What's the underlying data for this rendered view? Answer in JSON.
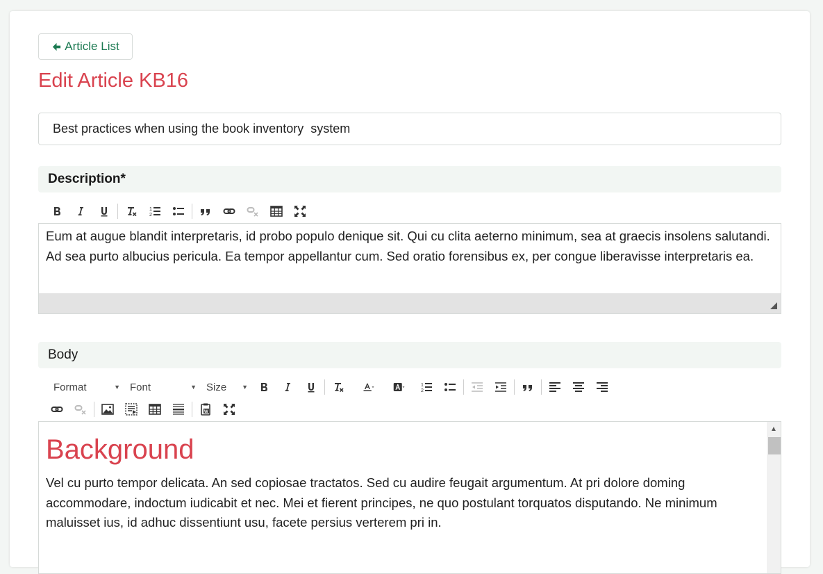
{
  "back_button": {
    "label": "Article List"
  },
  "page_title": "Edit Article KB16",
  "title_input": {
    "value": "Best practices when using the book inventory  system"
  },
  "description": {
    "label": "Description*",
    "text": "Eum at augue blandit interpretaris, id probo populo denique sit. Qui cu clita aeterno minimum, sea at graecis insolens salutandi. Ad sea purto albucius pericula. Ea tempor appellantur cum. Sed oratio forensibus ex, per congue liberavisse interpretaris ea."
  },
  "body": {
    "label": "Body",
    "format_combo": "Format",
    "font_combo": "Font",
    "size_combo": "Size",
    "heading": "Background",
    "text": "Vel cu purto tempor delicata. An sed copiosae tractatos. Sed cu audire feugait argumentum. At pri dolore doming accommodare, indoctum iudicabit et nec. Mei et fierent principes, ne quo postulant torquatos disputando. Ne minimum maluisset ius, id adhuc dissentiunt usu, facete persius verterem pri in."
  },
  "colors": {
    "accent_red": "#d9434f",
    "accent_green": "#1c7a52"
  }
}
